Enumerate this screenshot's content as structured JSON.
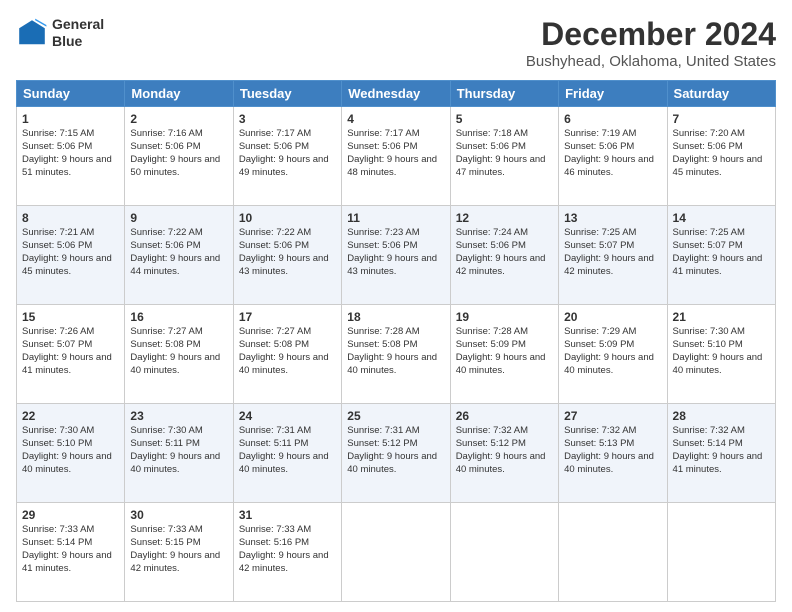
{
  "logo": {
    "line1": "General",
    "line2": "Blue"
  },
  "title": "December 2024",
  "location": "Bushyhead, Oklahoma, United States",
  "days_of_week": [
    "Sunday",
    "Monday",
    "Tuesday",
    "Wednesday",
    "Thursday",
    "Friday",
    "Saturday"
  ],
  "weeks": [
    [
      {
        "day": "1",
        "sunrise": "7:15 AM",
        "sunset": "5:06 PM",
        "daylight": "9 hours and 51 minutes."
      },
      {
        "day": "2",
        "sunrise": "7:16 AM",
        "sunset": "5:06 PM",
        "daylight": "9 hours and 50 minutes."
      },
      {
        "day": "3",
        "sunrise": "7:17 AM",
        "sunset": "5:06 PM",
        "daylight": "9 hours and 49 minutes."
      },
      {
        "day": "4",
        "sunrise": "7:17 AM",
        "sunset": "5:06 PM",
        "daylight": "9 hours and 48 minutes."
      },
      {
        "day": "5",
        "sunrise": "7:18 AM",
        "sunset": "5:06 PM",
        "daylight": "9 hours and 47 minutes."
      },
      {
        "day": "6",
        "sunrise": "7:19 AM",
        "sunset": "5:06 PM",
        "daylight": "9 hours and 46 minutes."
      },
      {
        "day": "7",
        "sunrise": "7:20 AM",
        "sunset": "5:06 PM",
        "daylight": "9 hours and 45 minutes."
      }
    ],
    [
      {
        "day": "8",
        "sunrise": "7:21 AM",
        "sunset": "5:06 PM",
        "daylight": "9 hours and 45 minutes."
      },
      {
        "day": "9",
        "sunrise": "7:22 AM",
        "sunset": "5:06 PM",
        "daylight": "9 hours and 44 minutes."
      },
      {
        "day": "10",
        "sunrise": "7:22 AM",
        "sunset": "5:06 PM",
        "daylight": "9 hours and 43 minutes."
      },
      {
        "day": "11",
        "sunrise": "7:23 AM",
        "sunset": "5:06 PM",
        "daylight": "9 hours and 43 minutes."
      },
      {
        "day": "12",
        "sunrise": "7:24 AM",
        "sunset": "5:06 PM",
        "daylight": "9 hours and 42 minutes."
      },
      {
        "day": "13",
        "sunrise": "7:25 AM",
        "sunset": "5:07 PM",
        "daylight": "9 hours and 42 minutes."
      },
      {
        "day": "14",
        "sunrise": "7:25 AM",
        "sunset": "5:07 PM",
        "daylight": "9 hours and 41 minutes."
      }
    ],
    [
      {
        "day": "15",
        "sunrise": "7:26 AM",
        "sunset": "5:07 PM",
        "daylight": "9 hours and 41 minutes."
      },
      {
        "day": "16",
        "sunrise": "7:27 AM",
        "sunset": "5:08 PM",
        "daylight": "9 hours and 40 minutes."
      },
      {
        "day": "17",
        "sunrise": "7:27 AM",
        "sunset": "5:08 PM",
        "daylight": "9 hours and 40 minutes."
      },
      {
        "day": "18",
        "sunrise": "7:28 AM",
        "sunset": "5:08 PM",
        "daylight": "9 hours and 40 minutes."
      },
      {
        "day": "19",
        "sunrise": "7:28 AM",
        "sunset": "5:09 PM",
        "daylight": "9 hours and 40 minutes."
      },
      {
        "day": "20",
        "sunrise": "7:29 AM",
        "sunset": "5:09 PM",
        "daylight": "9 hours and 40 minutes."
      },
      {
        "day": "21",
        "sunrise": "7:30 AM",
        "sunset": "5:10 PM",
        "daylight": "9 hours and 40 minutes."
      }
    ],
    [
      {
        "day": "22",
        "sunrise": "7:30 AM",
        "sunset": "5:10 PM",
        "daylight": "9 hours and 40 minutes."
      },
      {
        "day": "23",
        "sunrise": "7:30 AM",
        "sunset": "5:11 PM",
        "daylight": "9 hours and 40 minutes."
      },
      {
        "day": "24",
        "sunrise": "7:31 AM",
        "sunset": "5:11 PM",
        "daylight": "9 hours and 40 minutes."
      },
      {
        "day": "25",
        "sunrise": "7:31 AM",
        "sunset": "5:12 PM",
        "daylight": "9 hours and 40 minutes."
      },
      {
        "day": "26",
        "sunrise": "7:32 AM",
        "sunset": "5:12 PM",
        "daylight": "9 hours and 40 minutes."
      },
      {
        "day": "27",
        "sunrise": "7:32 AM",
        "sunset": "5:13 PM",
        "daylight": "9 hours and 40 minutes."
      },
      {
        "day": "28",
        "sunrise": "7:32 AM",
        "sunset": "5:14 PM",
        "daylight": "9 hours and 41 minutes."
      }
    ],
    [
      {
        "day": "29",
        "sunrise": "7:33 AM",
        "sunset": "5:14 PM",
        "daylight": "9 hours and 41 minutes."
      },
      {
        "day": "30",
        "sunrise": "7:33 AM",
        "sunset": "5:15 PM",
        "daylight": "9 hours and 42 minutes."
      },
      {
        "day": "31",
        "sunrise": "7:33 AM",
        "sunset": "5:16 PM",
        "daylight": "9 hours and 42 minutes."
      },
      null,
      null,
      null,
      null
    ]
  ],
  "labels": {
    "sunrise": "Sunrise:",
    "sunset": "Sunset:",
    "daylight": "Daylight:"
  }
}
